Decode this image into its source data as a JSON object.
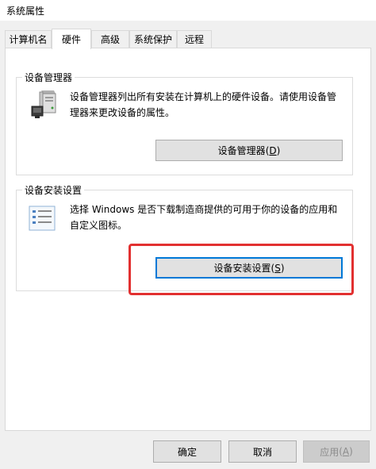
{
  "window": {
    "title": "系统属性"
  },
  "tabs": [
    {
      "label": "计算机名"
    },
    {
      "label": "硬件"
    },
    {
      "label": "高级"
    },
    {
      "label": "系统保护"
    },
    {
      "label": "远程"
    }
  ],
  "device_manager": {
    "group_label": "设备管理器",
    "description_line1": "设备管理器列出所有安装在计算机上的硬件设备。请使用设备管",
    "description_line2": "理器来更改设备的属性。",
    "button_text": "设备管理器",
    "button_hotkey": "D"
  },
  "device_install": {
    "group_label": "设备安装设置",
    "description_line1": "选择 Windows 是否下载制造商提供的可用于你的设备的应用和",
    "description_line2": "自定义图标。",
    "button_text": "设备安装设置",
    "button_hotkey": "S",
    "highlight_color": "#e23030"
  },
  "footer": {
    "ok_label": "确定",
    "cancel_label": "取消",
    "apply_text": "应用",
    "apply_hotkey": "A"
  }
}
